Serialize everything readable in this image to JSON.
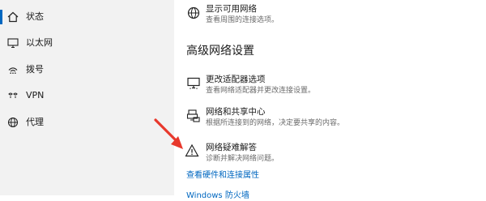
{
  "sidebar": {
    "items": [
      {
        "label": "状态",
        "icon": "home-icon",
        "active": true
      },
      {
        "label": "以太网",
        "icon": "monitor-icon",
        "active": false
      },
      {
        "label": "拨号",
        "icon": "dialup-icon",
        "active": false
      },
      {
        "label": "VPN",
        "icon": "vpn-icon",
        "active": false
      },
      {
        "label": "代理",
        "icon": "globe-icon",
        "active": false
      }
    ]
  },
  "main": {
    "top_item": {
      "title": "显示可用网络",
      "desc": "查看周围的连接选项。",
      "icon": "globe-icon"
    },
    "section_heading": "高级网络设置",
    "items": [
      {
        "title": "更改适配器选项",
        "desc": "查看网络适配器并更改连接设置。",
        "icon": "adapter-icon"
      },
      {
        "title": "网络和共享中心",
        "desc": "根据所连接到的网络，决定要共享的内容。",
        "icon": "sharing-icon"
      },
      {
        "title": "网络疑难解答",
        "desc": "诊断并解决网络问题。",
        "icon": "warning-icon"
      }
    ],
    "links": [
      "查看硬件和连接属性",
      "Windows 防火墙"
    ]
  },
  "colors": {
    "accent": "#0067c0",
    "sidebar_bg": "#f2f2f2",
    "annotation_arrow": "#e8382c"
  }
}
